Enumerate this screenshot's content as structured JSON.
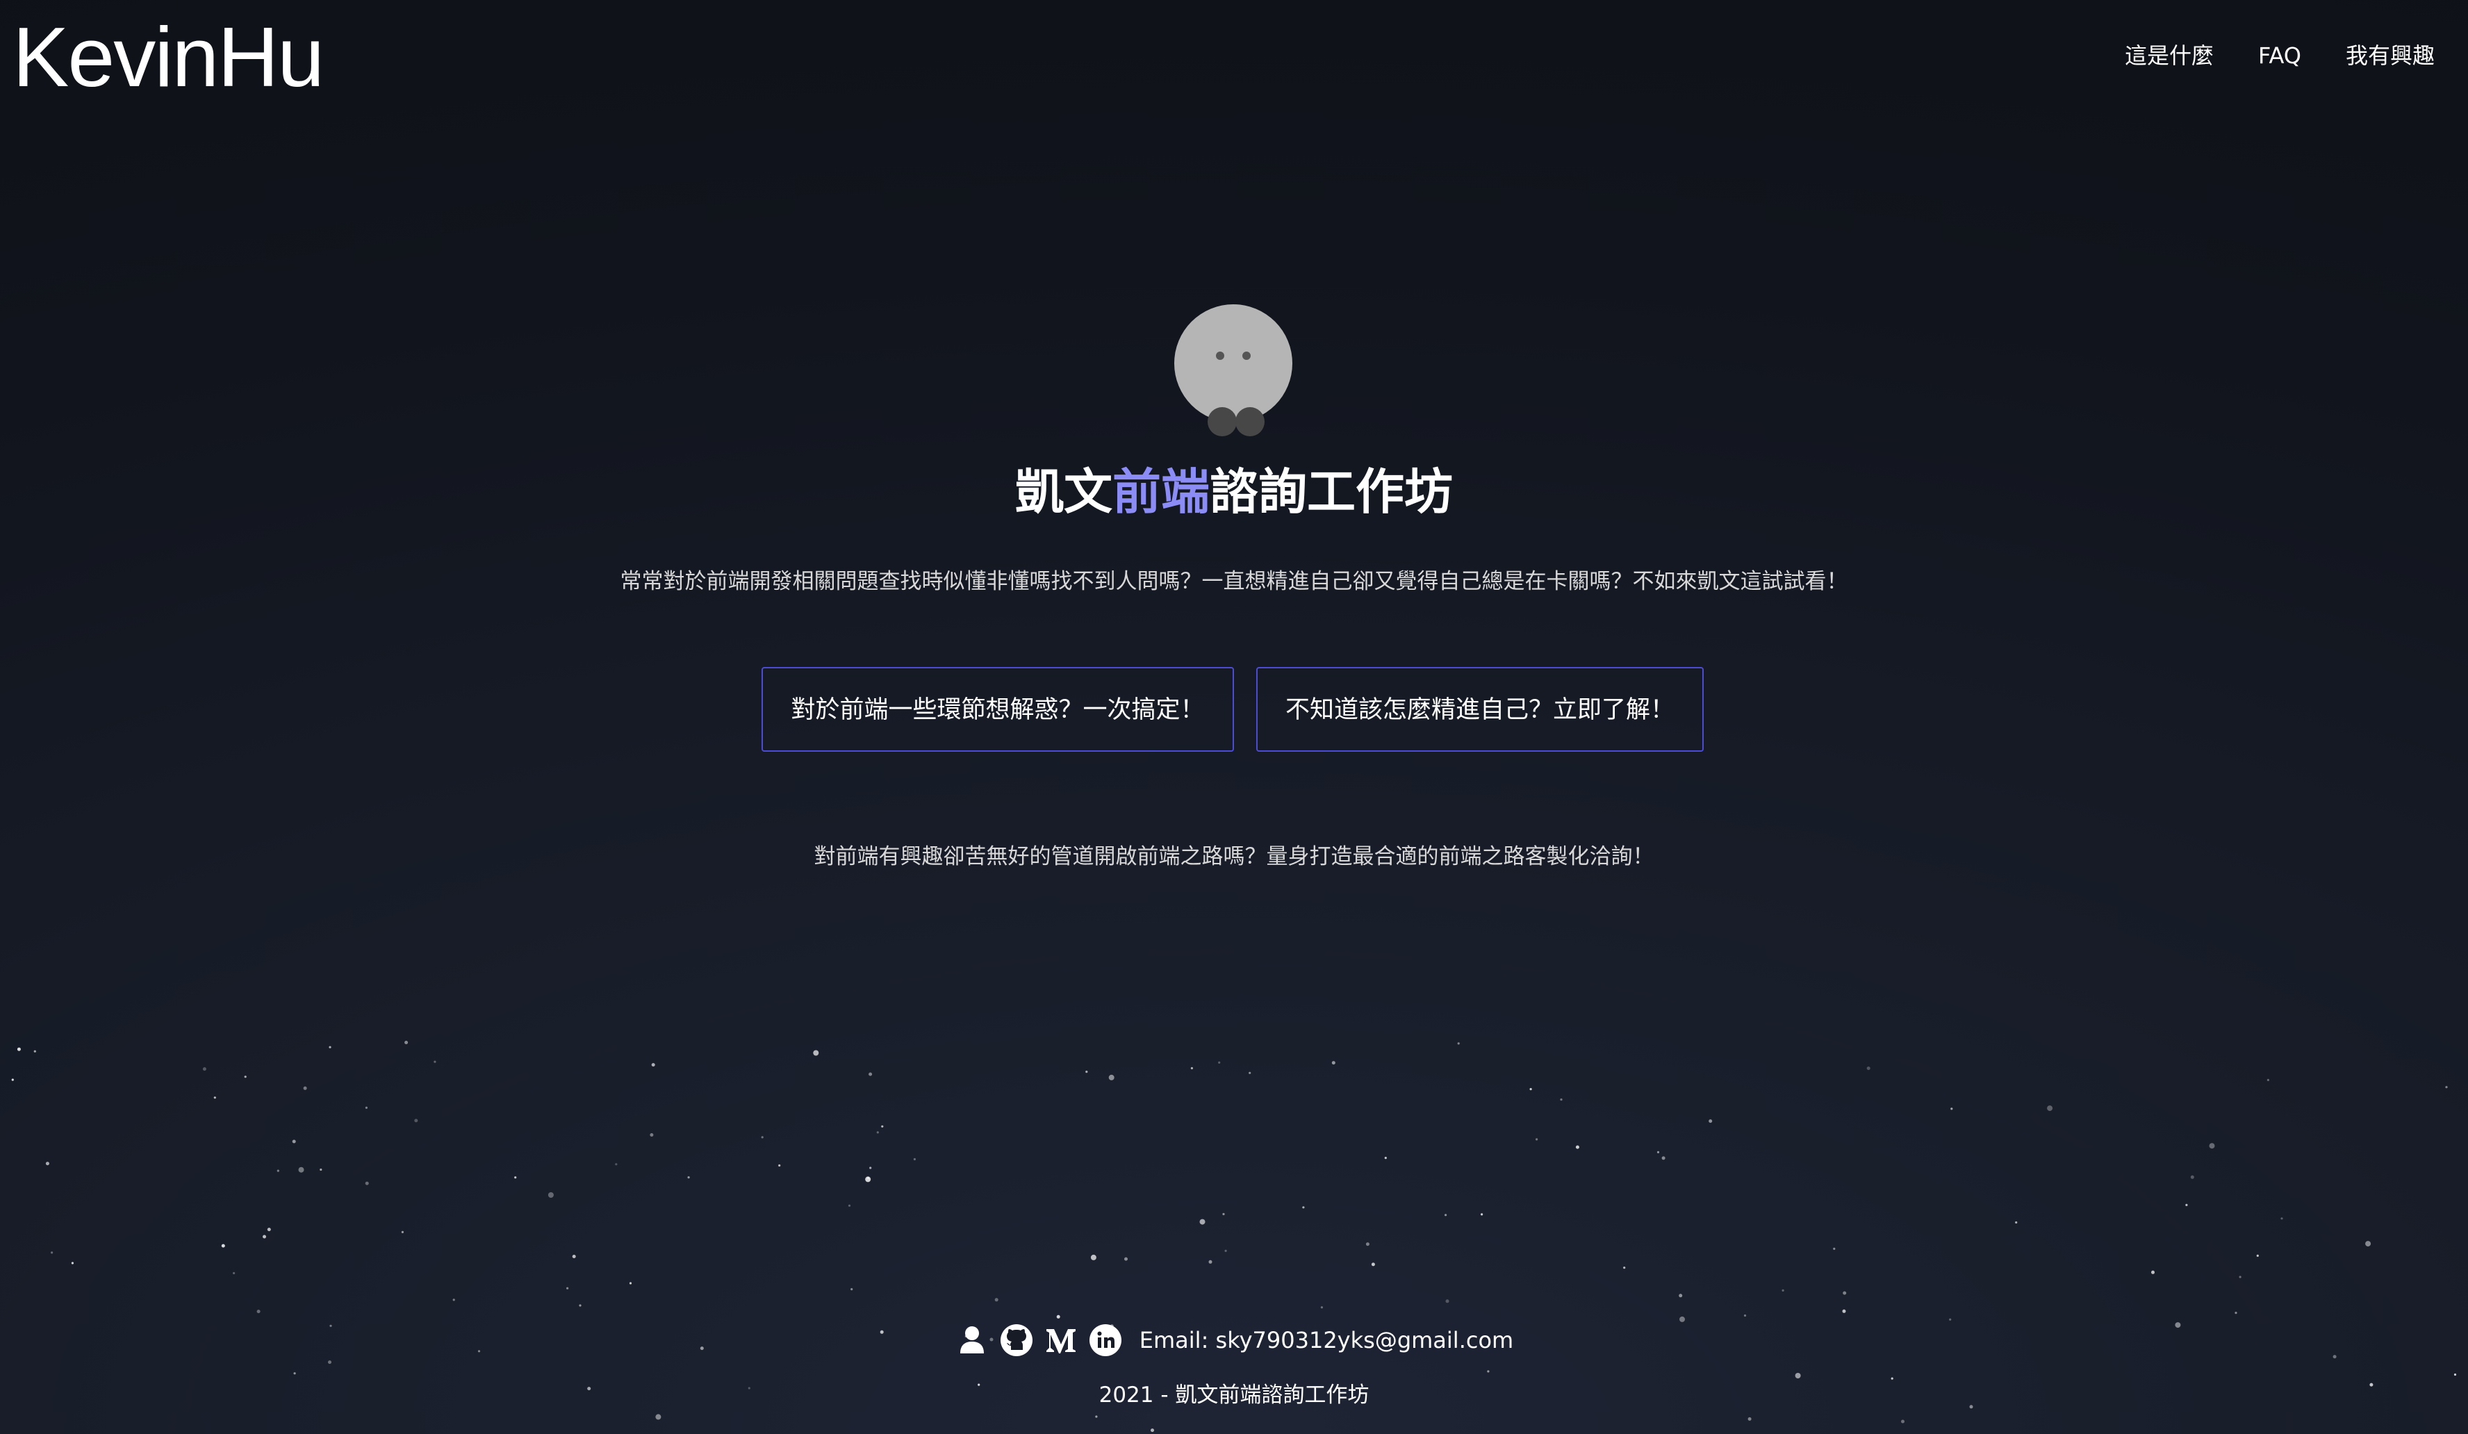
{
  "header": {
    "brand": "KevinHu",
    "nav": [
      {
        "label": "這是什麼"
      },
      {
        "label": "FAQ"
      },
      {
        "label": "我有興趣"
      }
    ]
  },
  "hero": {
    "title_prefix": "凱文",
    "title_accent": "前端",
    "title_suffix": "諮詢工作坊",
    "tagline": "常常對於前端開發相關問題查找時似懂非懂嗎找不到人問嗎？一直想精進自己卻又覺得自己總是在卡關嗎？不如來凱文這試試看！",
    "buttons": [
      {
        "label": "對於前端一些環節想解惑？一次搞定！"
      },
      {
        "label": "不知道該怎麼精進自己？立即了解！"
      }
    ],
    "sub_text": "對前端有興趣卻苦無好的管道開啟前端之路嗎？量身打造最合適的前端之路客製化洽詢！"
  },
  "footer": {
    "icons": [
      "user-icon",
      "github-icon",
      "medium-icon",
      "linkedin-icon"
    ],
    "email": "Email: sky790312yks@gmail.com",
    "copyright": "2021 - 凱文前端諮詢工作坊"
  },
  "colors": {
    "accent": "#8c8cf7",
    "button_border": "#4b4bd6",
    "background": "#12151d"
  }
}
